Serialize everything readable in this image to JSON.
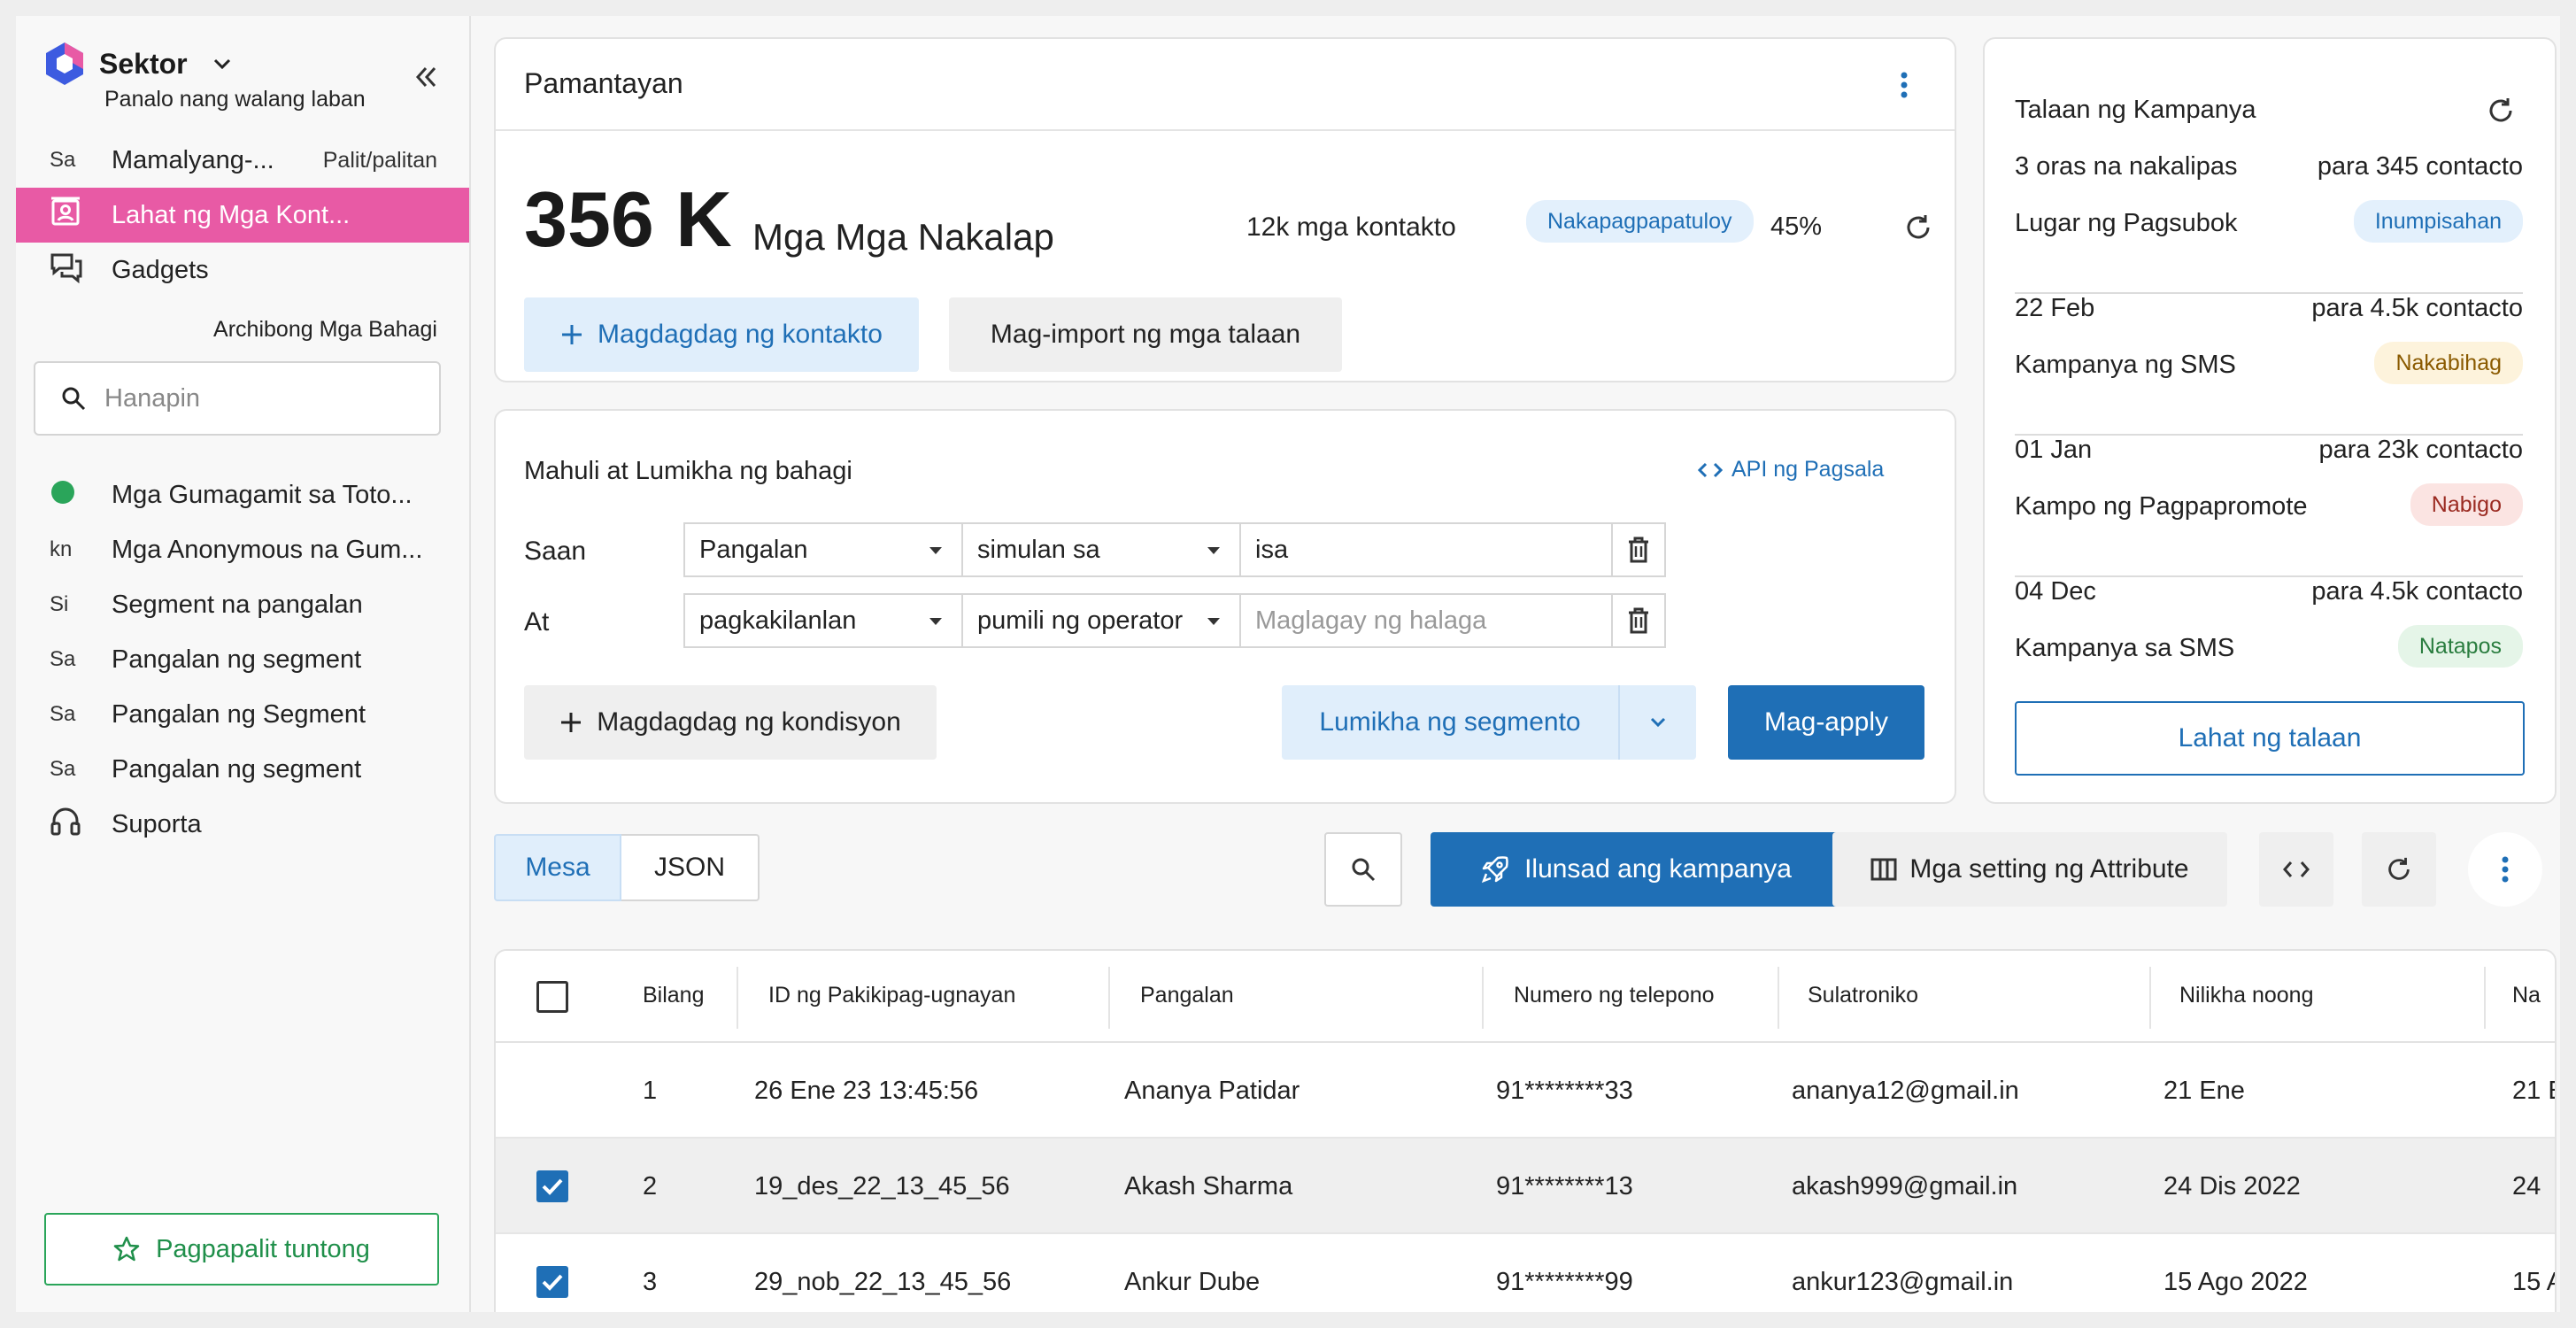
{
  "brand": {
    "name": "Sektor",
    "tagline": "Panalo nang walang laban",
    "logo_colors": [
      "#3d5be0",
      "#e85aa5"
    ]
  },
  "sidebar": {
    "items_top": [
      {
        "icon": "Sa",
        "label": "Mamalyang-...",
        "right": "Palit/palitan"
      },
      {
        "icon": "contacts-icon",
        "label": "Lahat ng Mga Kont...",
        "active": true
      },
      {
        "icon": "chat-icon",
        "label": "Gadgets"
      }
    ],
    "section_label": "Archibong Mga Bahagi",
    "search_placeholder": "Hanapin",
    "items_bottom": [
      {
        "icon": "green-dot-icon",
        "label": "Mga Gumagamit sa Toto..."
      },
      {
        "icon": "kn",
        "label": "Mga Anonymous na Gum..."
      },
      {
        "icon": "Si",
        "label": "Segment na pangalan"
      },
      {
        "icon": "Sa",
        "label": " Pangalan ng segment"
      },
      {
        "icon": "Sa",
        "label": "Pangalan ng Segment"
      },
      {
        "icon": "Sa",
        "label": " Pangalan ng segment"
      },
      {
        "icon": "headset-icon",
        "label": "Suporta"
      }
    ],
    "upgrade_label": "Pagpapalit tuntong"
  },
  "metrics": {
    "title": "Pamantayan",
    "big_number": "356 K",
    "big_subtitle": "Mga Mga Nakalap",
    "contacts_count": "12k mga kontakto",
    "status_badge": "Nakapagpapatuloy",
    "percent": "45%",
    "add_contact_label": "Magdagdag ng kontakto",
    "import_label": "Mag-import ng mga talaan"
  },
  "filter": {
    "title": "Mahuli at Lumikha ng bahagi",
    "api_label": "API ng Pagsala",
    "rows": [
      {
        "label": "Saan",
        "field": "Pangalan",
        "operator": "simulan sa",
        "value": "isa",
        "value_is_placeholder": false
      },
      {
        "label": "At",
        "field": "pagkakilanlan",
        "operator": "pumili ng operator",
        "value": "Maglagay ng halaga",
        "value_is_placeholder": true
      }
    ],
    "add_condition_label": "Magdagdag ng kondisyon",
    "create_segment_label": "Lumikha ng segmento",
    "apply_label": "Mag-apply"
  },
  "campaigns": {
    "title": "Talaan ng Kampanya",
    "items": [
      {
        "date": "3 oras na nakalipas",
        "para": "para 345 contacto",
        "name": "Lugar ng Pagsubok",
        "badge": "Inumpisahan",
        "badge_color": "blue"
      },
      {
        "date": "22 Feb",
        "para": "para 4.5k contacto",
        "name": "Kampanya ng SMS",
        "badge": "Nakabihag",
        "badge_color": "yellow"
      },
      {
        "date": "01 Jan",
        "para": "para 23k contacto",
        "name": "Kampo ng Pagpapromote",
        "badge": "Nabigo",
        "badge_color": "red"
      },
      {
        "date": "04 Dec",
        "para": "para 4.5k contacto",
        "name": "Kampanya sa SMS",
        "badge": "Natapos",
        "badge_color": "green"
      }
    ],
    "all_list_label": "Lahat ng talaan"
  },
  "toolbar": {
    "view_table": "Mesa",
    "view_json": "JSON",
    "launch_label": "Ilunsad ang kampanya",
    "attr_settings_label": "Mga setting ng Attribute"
  },
  "table": {
    "columns": [
      "Bilang",
      "ID ng Pakikipag-ugnayan",
      "Pangalan",
      "Numero ng telepono",
      "Sulatroniko",
      "Nilikha noong",
      "Na"
    ],
    "rows": [
      {
        "checkbox": "none",
        "num": "1",
        "id": "26 Ene 23 13:45:56",
        "name": "Ananya Patidar",
        "phone": "91********33",
        "email": "ananya12@gmail.in",
        "created": "21 Ene",
        "extra": "21 E"
      },
      {
        "checkbox": "checked",
        "num": "2",
        "id": "19_des_22_13_45_56",
        "name": "Akash Sharma",
        "phone": "91********13",
        "email": "akash999@gmail.in",
        "created": "24 Dis 2022",
        "extra": "24"
      },
      {
        "checkbox": "checked",
        "num": "3",
        "id": "29_nob_22_13_45_56",
        "name": "Ankur Dube",
        "phone": "91********99",
        "email": "ankur123@gmail.in",
        "created": "15 Ago 2022",
        "extra": "15 A"
      }
    ]
  },
  "colors": {
    "accent": "#1f6fb6",
    "active_nav": "#e85aa5",
    "success": "#2aa55a"
  }
}
